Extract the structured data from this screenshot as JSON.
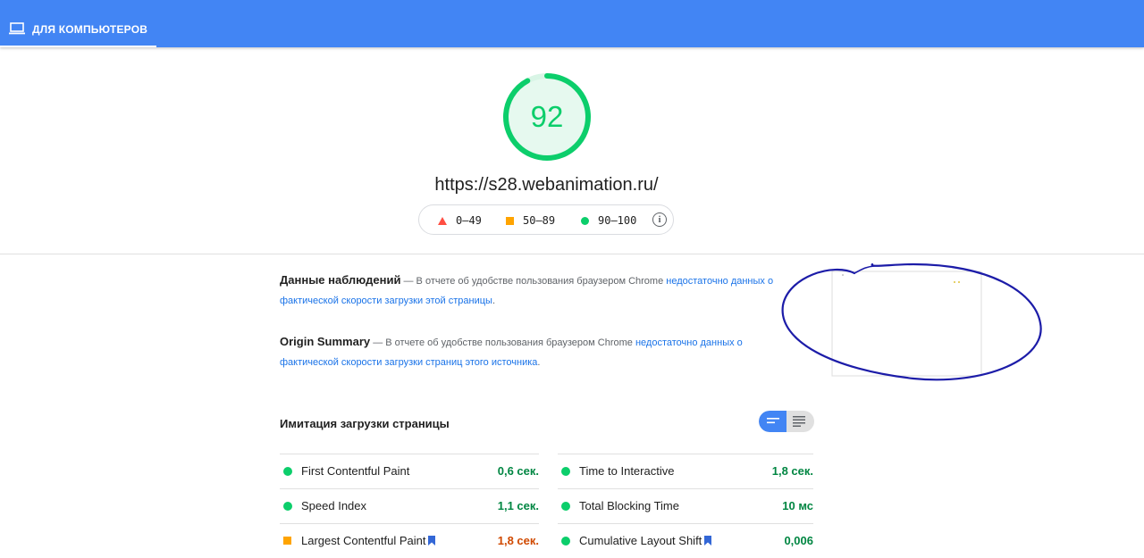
{
  "tabs": [
    {
      "label": "ДЛЯ КОМПЬЮТЕРОВ",
      "icon": "laptop-icon",
      "active": true
    }
  ],
  "score": {
    "value": "92",
    "color": "#0cce6b",
    "fraction": 0.92
  },
  "url": "https://s28.webanimation.ru/",
  "legend": [
    {
      "range": "0–49",
      "shape": "triangle",
      "color": "#ff4e42"
    },
    {
      "range": "50–89",
      "shape": "square",
      "color": "#ffa400"
    },
    {
      "range": "90–100",
      "shape": "circle",
      "color": "#0cce6b"
    }
  ],
  "field_data": {
    "title": "Данные наблюдений",
    "dash_text": " — В отчете об удобстве пользования браузером Chrome ",
    "link": "недостаточно данных о фактической скорости загрузки этой страницы",
    "end": "."
  },
  "origin_summary": {
    "title": "Origin Summary",
    "dash_text": " — В отчете об удобстве пользования браузером Chrome ",
    "link": "недостаточно данных о фактической скорости загрузки страниц этого источника",
    "end": "."
  },
  "lab": {
    "title": "Имитация загрузки страницы",
    "view_toggle": {
      "active": "compact"
    },
    "metrics_left": [
      {
        "label": "First Contentful Paint",
        "value": "0,6 сек.",
        "status": "pass",
        "color": "#018642",
        "bookmark": false
      },
      {
        "label": "Speed Index",
        "value": "1,1 сек.",
        "status": "pass",
        "color": "#018642",
        "bookmark": false
      },
      {
        "label": "Largest Contentful Paint",
        "value": "1,8 сек.",
        "status": "average",
        "color": "#d04900",
        "bookmark": true
      }
    ],
    "metrics_right": [
      {
        "label": "Time to Interactive",
        "value": "1,8 сек.",
        "status": "pass",
        "color": "#018642",
        "bookmark": false
      },
      {
        "label": "Total Blocking Time",
        "value": "10 мс",
        "status": "pass",
        "color": "#018642",
        "bookmark": false
      },
      {
        "label": "Cumulative Layout Shift",
        "value": "0,006",
        "status": "pass",
        "color": "#018642",
        "bookmark": true
      }
    ]
  }
}
